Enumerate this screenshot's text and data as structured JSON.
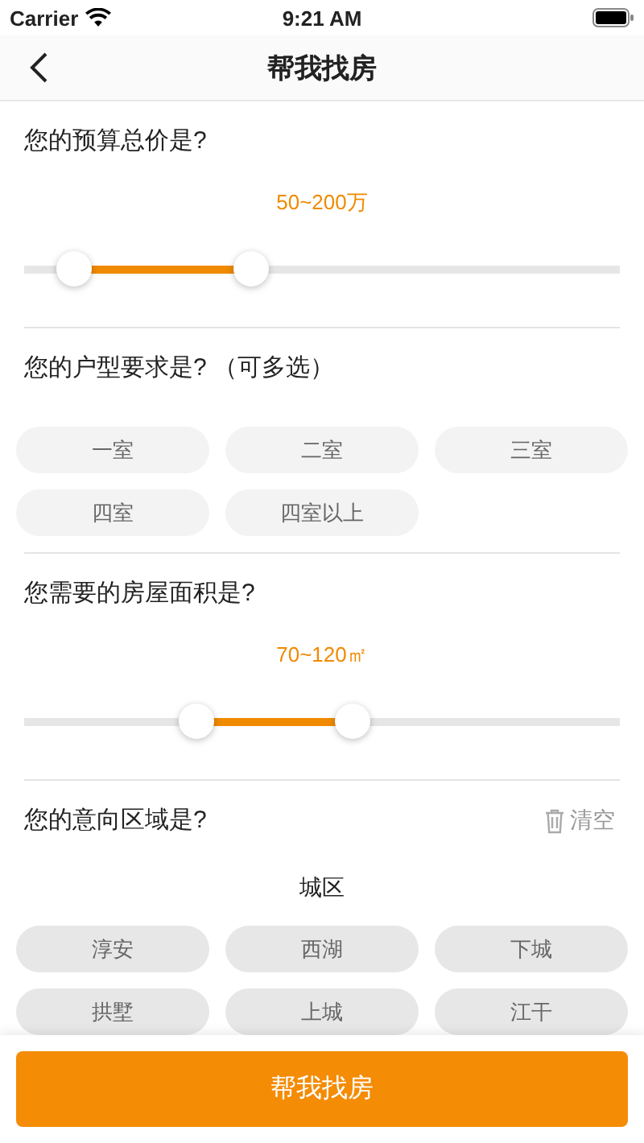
{
  "status_bar": {
    "carrier": "Carrier",
    "time": "9:21 AM"
  },
  "nav": {
    "title": "帮我找房"
  },
  "sections": [
    {
      "kind": "range",
      "question": "您的预算总价是?",
      "reading": "50~200万",
      "thumbs": [
        {
          "level": 0.084
        },
        {
          "level": 0.38
        }
      ]
    },
    {
      "kind": "chips",
      "question": "您的户型要求是? （可多选）",
      "options": [
        {
          "label": "一室",
          "selected": false
        },
        {
          "label": "二室",
          "selected": false
        },
        {
          "label": "三室",
          "selected": false
        },
        {
          "label": "四室",
          "selected": false
        },
        {
          "label": "四室以上",
          "selected": false
        }
      ]
    },
    {
      "kind": "range",
      "question": "您需要的房屋面积是?",
      "reading": "70~120㎡",
      "thumbs": [
        {
          "level": 0.289
        },
        {
          "level": 0.551
        }
      ]
    },
    {
      "kind": "area",
      "question": "您的意向区域是?",
      "clear": "清空",
      "group": "城区",
      "options": [
        {
          "label": "淳安",
          "selected": false
        },
        {
          "label": "西湖",
          "selected": false
        },
        {
          "label": "下城",
          "selected": false
        },
        {
          "label": "拱墅",
          "selected": false
        },
        {
          "label": "上城",
          "selected": false
        },
        {
          "label": "江干",
          "selected": false
        }
      ]
    }
  ],
  "submit": "帮我找房"
}
